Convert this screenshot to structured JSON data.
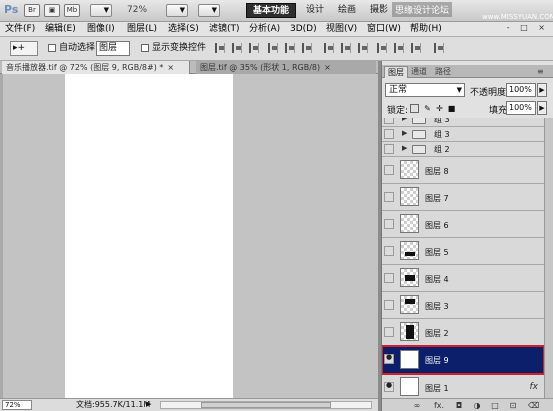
{
  "appbar": {
    "logo": "Ps",
    "zoom": "72%",
    "workspace_buttons": [
      "基本功能",
      "设计",
      "绘画",
      "摄影"
    ],
    "watermark": "思缘设计论坛",
    "watermark_url": "www.MISSYUAN.COM"
  },
  "menu": {
    "items": [
      "文件(F)",
      "编辑(E)",
      "图像(I)",
      "图层(L)",
      "选择(S)",
      "滤镜(T)",
      "分析(A)",
      "3D(D)",
      "视图(V)",
      "窗口(W)",
      "帮助(H)"
    ],
    "window_controls": "- □ ×"
  },
  "options": {
    "tool_preset": "▸+",
    "auto_select_label": "自动选择:",
    "auto_select_value": "图层",
    "transform_label": "显示变换控件"
  },
  "doc_tabs": [
    {
      "label": "音乐播放器.tif @ 72% (图层 9, RGB/8#) *",
      "close": "×"
    },
    {
      "label": "图层.tif @ 35% (形状 1, RGB/8)",
      "close": "×"
    }
  ],
  "status": {
    "zoom": "72%",
    "doc_info": "文档:955.7K/11.1M",
    "arrow": "▶"
  },
  "panel": {
    "tabs": [
      "图层",
      "通道",
      "路径"
    ],
    "blend_mode": "正常",
    "opacity_label": "不透明度:",
    "opacity_value": "100%",
    "lock_label": "锁定:",
    "fill_label": "填充:",
    "fill_value": "100%",
    "layers": [
      {
        "name": "组 3",
        "type": "group"
      },
      {
        "name": "组 3",
        "type": "group"
      },
      {
        "name": "组 2",
        "type": "group"
      },
      {
        "name": "图层 8",
        "type": "layer"
      },
      {
        "name": "图层 7",
        "type": "layer"
      },
      {
        "name": "图层 6",
        "type": "layer"
      },
      {
        "name": "图层 5",
        "type": "layer"
      },
      {
        "name": "图层 4",
        "type": "layer"
      },
      {
        "name": "图层 3",
        "type": "layer"
      },
      {
        "name": "图层 2",
        "type": "layer"
      },
      {
        "name": "图层 9",
        "type": "layer",
        "selected": true,
        "visible": true
      },
      {
        "name": "图层 1",
        "type": "layer",
        "visible": true,
        "fx": "fx"
      }
    ],
    "footer_icons": [
      "link-icon",
      "fx-icon",
      "mask-icon",
      "adjustment-icon",
      "group-icon",
      "new-layer-icon",
      "trash-icon"
    ],
    "footer_glyphs": [
      "∞",
      "fx.",
      "◘",
      "◑",
      "□",
      "⊡",
      "⌫"
    ]
  },
  "colors": {
    "selected_row": "#0b1f6a",
    "highlight_outline": "#d0202a"
  }
}
